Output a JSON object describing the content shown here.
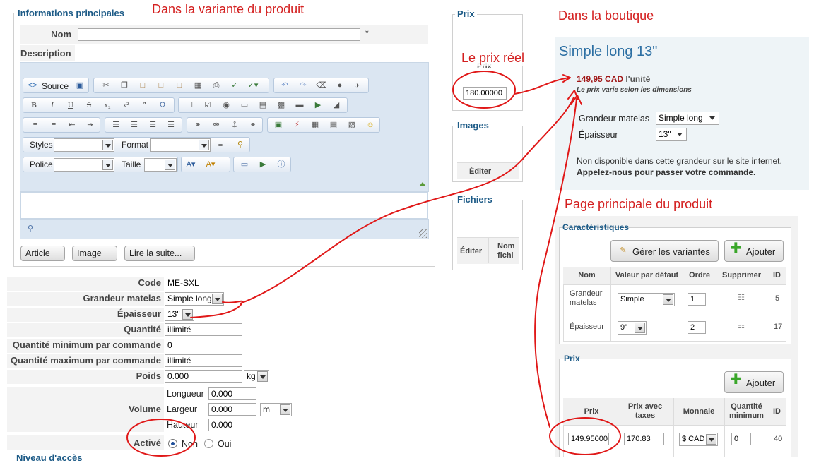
{
  "annotations": {
    "variant": "Dans la variante du produit",
    "real_price": "Le prix réel",
    "shop": "Dans la boutique",
    "main_page": "Page principale du produit"
  },
  "main_info": {
    "legend": "Informations principales",
    "name_label": "Nom",
    "name_value": "",
    "required_mark": "*",
    "description_label": "Description"
  },
  "editor": {
    "source_label": "Source",
    "styles_label": "Styles",
    "format_label": "Format",
    "police_label": "Police",
    "taille_label": "Taille",
    "buttons": [
      "Article",
      "Image",
      "Lire la suite..."
    ]
  },
  "variant_fields": {
    "code_label": "Code",
    "code_value": "ME-SXL",
    "grandeur_label": "Grandeur matelas",
    "grandeur_value": "Simple long",
    "epaisseur_label": "Épaisseur",
    "epaisseur_value": "13\"",
    "quantite_label": "Quantité",
    "quantite_value": "illimité",
    "qmin_label": "Quantité minimum par commande",
    "qmin_value": "0",
    "qmax_label": "Quantité maximum par commande",
    "qmax_value": "illimité",
    "poids_label": "Poids",
    "poids_value": "0.000",
    "poids_unit": "kg",
    "volume_label": "Volume",
    "longueur_label": "Longueur",
    "longueur_value": "0.000",
    "largeur_label": "Largeur",
    "largeur_value": "0.000",
    "volume_unit": "m",
    "hauteur_label": "Hauteur",
    "hauteur_value": "0.000",
    "active_label": "Activé",
    "opt_non": "Non",
    "opt_oui": "Oui",
    "niveau_label": "Niveau d'accès"
  },
  "middle": {
    "prix_legend": "Prix",
    "prix_small": "Prix",
    "prix_value": "180.00000",
    "images_legend": "Images",
    "images_edit": "Éditer",
    "fichiers_legend": "Fichiers",
    "fichiers_edit": "Éditer",
    "fichiers_name": "Nom fichi"
  },
  "shop": {
    "title": "Simple long 13\"",
    "price": "149,95 CAD",
    "price_unit": "l'unité",
    "price_note": "Le prix varie selon les dimensions",
    "grandeur_label": "Grandeur matelas",
    "grandeur_value": "Simple long",
    "epaisseur_label": "Épaisseur",
    "epaisseur_value": "13\"",
    "unavailable": "Non disponible dans cette grandeur sur le site internet.",
    "call_us": "Appelez-nous pour passer votre commande."
  },
  "characteristics": {
    "legend": "Caractéristiques",
    "manage_label": "Gérer les variantes",
    "add_label": "Ajouter",
    "headers": [
      "Nom",
      "Valeur par défaut",
      "Ordre",
      "Supprimer",
      "ID"
    ],
    "rows": [
      {
        "name": "Grandeur matelas",
        "default": "Simple",
        "order": "1",
        "id": "5"
      },
      {
        "name": "Épaisseur",
        "default": "9\"",
        "order": "2",
        "id": "17"
      }
    ]
  },
  "price_section": {
    "legend": "Prix",
    "add_label": "Ajouter",
    "headers": [
      "Prix",
      "Prix avec taxes",
      "Monnaie",
      "Quantité minimum",
      "ID"
    ],
    "row": {
      "prix": "149.95000",
      "prix_taxes": "170.83",
      "monnaie": "$ CAD",
      "qmin": "0",
      "id": "40"
    }
  }
}
